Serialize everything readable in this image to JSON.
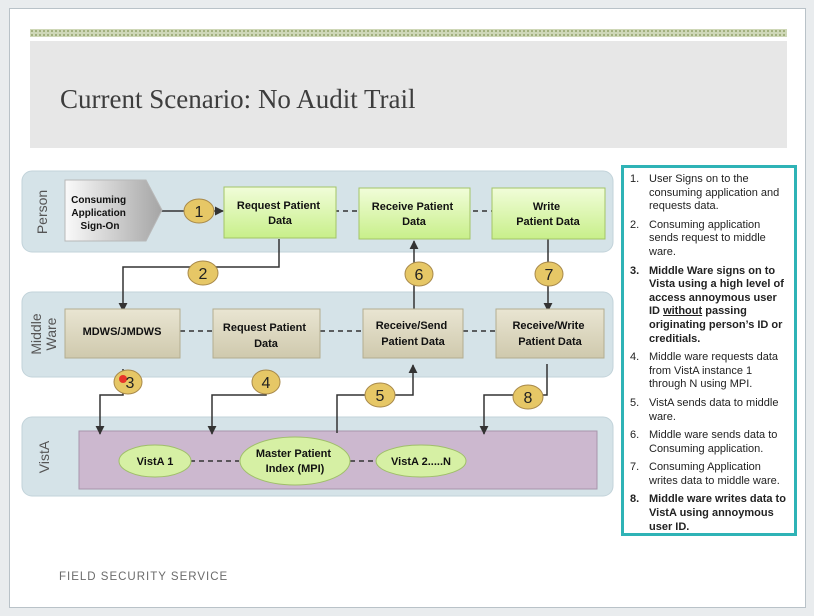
{
  "slide": {
    "title": "Current Scenario: No Audit Trail",
    "footer": "FIELD SECURITY SERVICE"
  },
  "lanes": {
    "person": "Person",
    "middleware_line1": "Middle",
    "middleware_line2": "Ware",
    "vista": "VistA"
  },
  "boxes": {
    "consuming_app": [
      "Consuming",
      "Application",
      "Sign-On"
    ],
    "request_patient_data_top": [
      "Request Patient",
      "Data"
    ],
    "receive_patient_data": [
      "Receive Patient",
      "Data"
    ],
    "write_patient_data": [
      "Write",
      "Patient Data"
    ],
    "mdws": [
      "MDWS/JMDWS"
    ],
    "request_patient_data_mid": [
      "Request Patient",
      "Data"
    ],
    "receive_send_patient_data": [
      "Receive/Send",
      "Patient Data"
    ],
    "receive_write_patient_data": [
      "Receive/Write",
      "Patient Data"
    ],
    "vista1": [
      "VistA 1"
    ],
    "mpi": [
      "Master Patient",
      "Index (MPI)"
    ],
    "vista2n": [
      "VistA 2.....N"
    ]
  },
  "steps": [
    "1",
    "2",
    "3",
    "4",
    "5",
    "6",
    "7",
    "8"
  ],
  "notes": [
    {
      "num": "1.",
      "text": "User Signs on to the consuming application and requests data.",
      "bold": false
    },
    {
      "num": "2.",
      "text": "Consuming application sends request to middle ware.",
      "bold": false
    },
    {
      "num": "3.",
      "text": "Middle Ware signs on to Vista using a high level of access annoymous user ID without passing originating person’s ID or creditials.",
      "bold": true
    },
    {
      "num": "4.",
      "text": "Middle ware requests  data from VistA instance 1 through N using MPI.",
      "bold": false
    },
    {
      "num": "5.",
      "text": "VistA sends data to middle ware.",
      "bold": false
    },
    {
      "num": "6.",
      "text": "Middle ware sends data to Consuming application.",
      "bold": false
    },
    {
      "num": "7.",
      "text": "Consuming Application writes data to middle ware.",
      "bold": false
    },
    {
      "num": "8.",
      "text": "Middle ware writes data to VistA using annoymous user ID.",
      "bold": true
    }
  ],
  "colors": {
    "lane_fill": "#d5e3e8",
    "process_box_fill": "#d9f5a8",
    "middleware_box_fill": "#ddd8c1",
    "vista_fill": "#ccb8cf",
    "ellipse_fill": "#d6f0a4",
    "step_circle_fill": "#e6c766",
    "notes_border": "#2fb3b6"
  }
}
